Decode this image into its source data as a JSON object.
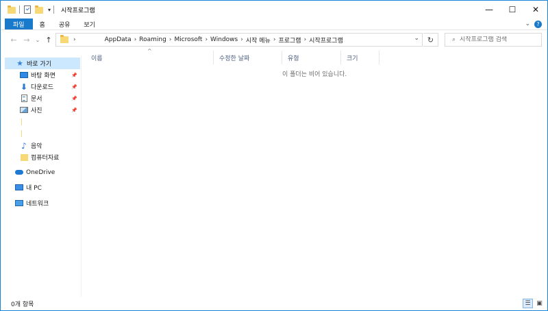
{
  "window": {
    "title": "시작프로그램",
    "controls": {
      "minimize": "—",
      "maximize": "☐",
      "close": "✕"
    }
  },
  "ribbon": {
    "tabs": [
      {
        "label": "파일",
        "active": true
      },
      {
        "label": "홈"
      },
      {
        "label": "공유"
      },
      {
        "label": "보기"
      }
    ],
    "expand_glyph": "⌄",
    "help_glyph": "?"
  },
  "navigation": {
    "back_glyph": "←",
    "forward_glyph": "→",
    "recent_glyph": "⌄",
    "up_glyph": "↑",
    "breadcrumbs": [
      "AppData",
      "Roaming",
      "Microsoft",
      "Windows",
      "시작 메뉴",
      "프로그램",
      "시작프로그램"
    ],
    "refresh_glyph": "↻",
    "search_placeholder": "시작프로그램 검색",
    "search_glyph": "⌕"
  },
  "sidebar": {
    "quick_access": "바로 가기",
    "pinned": [
      {
        "label": "바탕 화면",
        "icon": "desktop-icon"
      },
      {
        "label": "다운로드",
        "icon": "download-icon"
      },
      {
        "label": "문서",
        "icon": "documents-icon"
      },
      {
        "label": "사진",
        "icon": "pictures-icon"
      }
    ],
    "other": [
      {
        "label": "음악",
        "icon": "music-icon"
      },
      {
        "label": "컴퓨터자료",
        "icon": "folder-icon"
      }
    ],
    "onedrive": "OneDrive",
    "this_pc": "내 PC",
    "network": "네트워크"
  },
  "content": {
    "columns": [
      "이름",
      "수정한 날짜",
      "유형",
      "크기"
    ],
    "empty_message": "이 폴더는 비어 있습니다."
  },
  "status": {
    "item_count": "0개 항목"
  },
  "colors": {
    "accent": "#1979ca",
    "selected": "#cce8ff",
    "border": "#1883d7"
  }
}
